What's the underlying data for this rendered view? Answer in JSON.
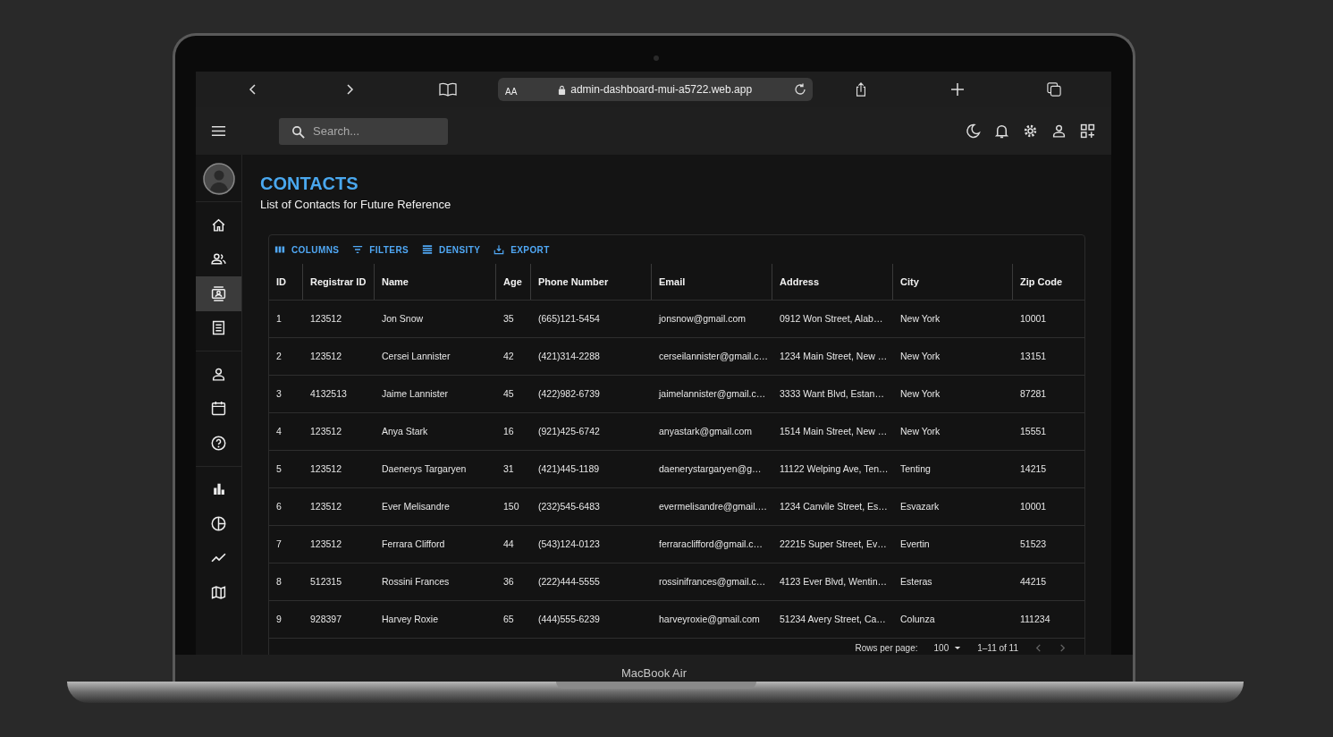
{
  "browser": {
    "text_size": "AA",
    "url": "admin-dashboard-mui-a5722.web.app"
  },
  "topbar": {
    "search": {
      "placeholder": "Search..."
    }
  },
  "sidebar": {
    "groups": [
      [
        {
          "selected": false
        },
        {
          "selected": false
        },
        {
          "selected": true
        },
        {
          "selected": false
        }
      ],
      [
        {
          "selected": false
        },
        {
          "selected": false
        },
        {
          "selected": false
        }
      ],
      [
        {
          "selected": false
        },
        {
          "selected": false
        },
        {
          "selected": false
        },
        {
          "selected": false
        }
      ]
    ]
  },
  "header": {
    "title": "CONTACTS",
    "subtitle": "List of Contacts for Future Reference"
  },
  "grid": {
    "toolbar": [
      "COLUMNS",
      "FILTERS",
      "DENSITY",
      "EXPORT"
    ],
    "columns": [
      "ID",
      "Registrar ID",
      "Name",
      "Age",
      "Phone Number",
      "Email",
      "Address",
      "City",
      "Zip Code"
    ],
    "rows": [
      [
        "1",
        "123512",
        "Jon Snow",
        "35",
        "(665)121-5454",
        "jonsnow@gmail.com",
        "0912 Won Street, Alab…",
        "New York",
        "10001"
      ],
      [
        "2",
        "123512",
        "Cersei Lannister",
        "42",
        "(421)314-2288",
        "cerseilannister@gmail.c…",
        "1234 Main Street, New …",
        "New York",
        "13151"
      ],
      [
        "3",
        "4132513",
        "Jaime Lannister",
        "45",
        "(422)982-6739",
        "jaimelannister@gmail.c…",
        "3333 Want Blvd, Estan…",
        "New York",
        "87281"
      ],
      [
        "4",
        "123512",
        "Anya Stark",
        "16",
        "(921)425-6742",
        "anyastark@gmail.com",
        "1514 Main Street, New …",
        "New York",
        "15551"
      ],
      [
        "5",
        "123512",
        "Daenerys Targaryen",
        "31",
        "(421)445-1189",
        "daenerystargaryen@g…",
        "11122 Welping Ave, Ten…",
        "Tenting",
        "14215"
      ],
      [
        "6",
        "123512",
        "Ever Melisandre",
        "150",
        "(232)545-6483",
        "evermelisandre@gmail.…",
        "1234 Canvile Street, Es…",
        "Esvazark",
        "10001"
      ],
      [
        "7",
        "123512",
        "Ferrara Clifford",
        "44",
        "(543)124-0123",
        "ferraraclifford@gmail.c…",
        "22215 Super Street, Ev…",
        "Evertin",
        "51523"
      ],
      [
        "8",
        "512315",
        "Rossini Frances",
        "36",
        "(222)444-5555",
        "rossinifrances@gmail.c…",
        "4123 Ever Blvd, Wentin…",
        "Esteras",
        "44215"
      ],
      [
        "9",
        "928397",
        "Harvey Roxie",
        "65",
        "(444)555-6239",
        "harveyroxie@gmail.com",
        "51234 Avery Street, Ca…",
        "Colunza",
        "111234"
      ]
    ],
    "footer": {
      "rows_per_page_label": "Rows per page:",
      "rows_per_page": "100",
      "range": "1–11 of 11"
    }
  },
  "device": {
    "label": "MacBook Air"
  }
}
